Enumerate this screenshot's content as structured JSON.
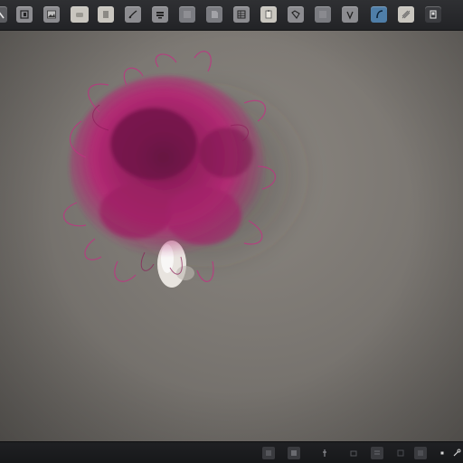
{
  "toolbar": {
    "tools": [
      {
        "icon": "select-arrow-icon"
      },
      {
        "icon": "frame-icon"
      },
      {
        "icon": "image-icon"
      },
      {
        "icon": "eraser-icon"
      },
      {
        "icon": "document-icon"
      },
      {
        "icon": "brush-icon"
      },
      {
        "icon": "layers-icon"
      },
      {
        "icon": "blank-icon"
      },
      {
        "icon": "page-icon"
      },
      {
        "icon": "grid-icon"
      },
      {
        "icon": "clipboard-icon"
      },
      {
        "icon": "transform-icon"
      },
      {
        "icon": "blank-icon"
      },
      {
        "icon": "pen-icon"
      },
      {
        "icon": "curve-icon"
      },
      {
        "icon": "gradient-icon"
      },
      {
        "icon": "panel-icon"
      }
    ]
  },
  "viewport": {
    "subject": "pink-fur-pompom",
    "colors": {
      "background": "#7b7772",
      "fur": "#b12a73",
      "fur_dark": "#5a1138",
      "stem": "#e8e4df"
    }
  },
  "statusbar": {
    "icons": [
      "layer-icon",
      "square-icon",
      "pin-icon",
      "undo-icon",
      "grid-icon",
      "panel-icon",
      "dot-icon",
      "link-icon"
    ]
  }
}
